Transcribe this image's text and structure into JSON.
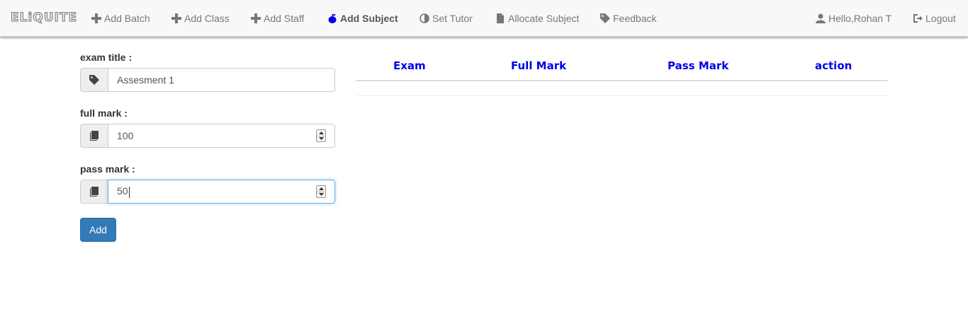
{
  "navbar": {
    "brand": "ELiQUITE",
    "items": [
      {
        "label": "Add Batch",
        "icon": "plus-icon"
      },
      {
        "label": "Add Class",
        "icon": "plus-icon"
      },
      {
        "label": "Add Staff",
        "icon": "plus-icon"
      },
      {
        "label": "Add Subject",
        "icon": "apple-icon",
        "active": true
      },
      {
        "label": "Set Tutor",
        "icon": "contrast-icon"
      },
      {
        "label": "Allocate Subject",
        "icon": "file-icon"
      },
      {
        "label": "Feedback",
        "icon": "tag-icon"
      }
    ],
    "user": {
      "label": "Hello,Rohan T",
      "icon": "user-icon"
    },
    "logout": {
      "label": "Logout",
      "icon": "logout-icon"
    }
  },
  "form": {
    "exam_title": {
      "label": "exam title :",
      "value": "Assesment 1",
      "icon": "tag-icon"
    },
    "full_mark": {
      "label": "full mark :",
      "value": "100",
      "icon": "book-icon"
    },
    "pass_mark": {
      "label": "pass mark :",
      "value": "50",
      "icon": "book-icon"
    },
    "add_button": "Add"
  },
  "table": {
    "columns": [
      "Exam",
      "Full Mark",
      "Pass Mark",
      "action"
    ],
    "rows": []
  },
  "colors": {
    "primary": "#337ab7",
    "table_header": "#0000e6",
    "navbar_bg": "#f8f8f8",
    "focus": "#66afe9"
  }
}
